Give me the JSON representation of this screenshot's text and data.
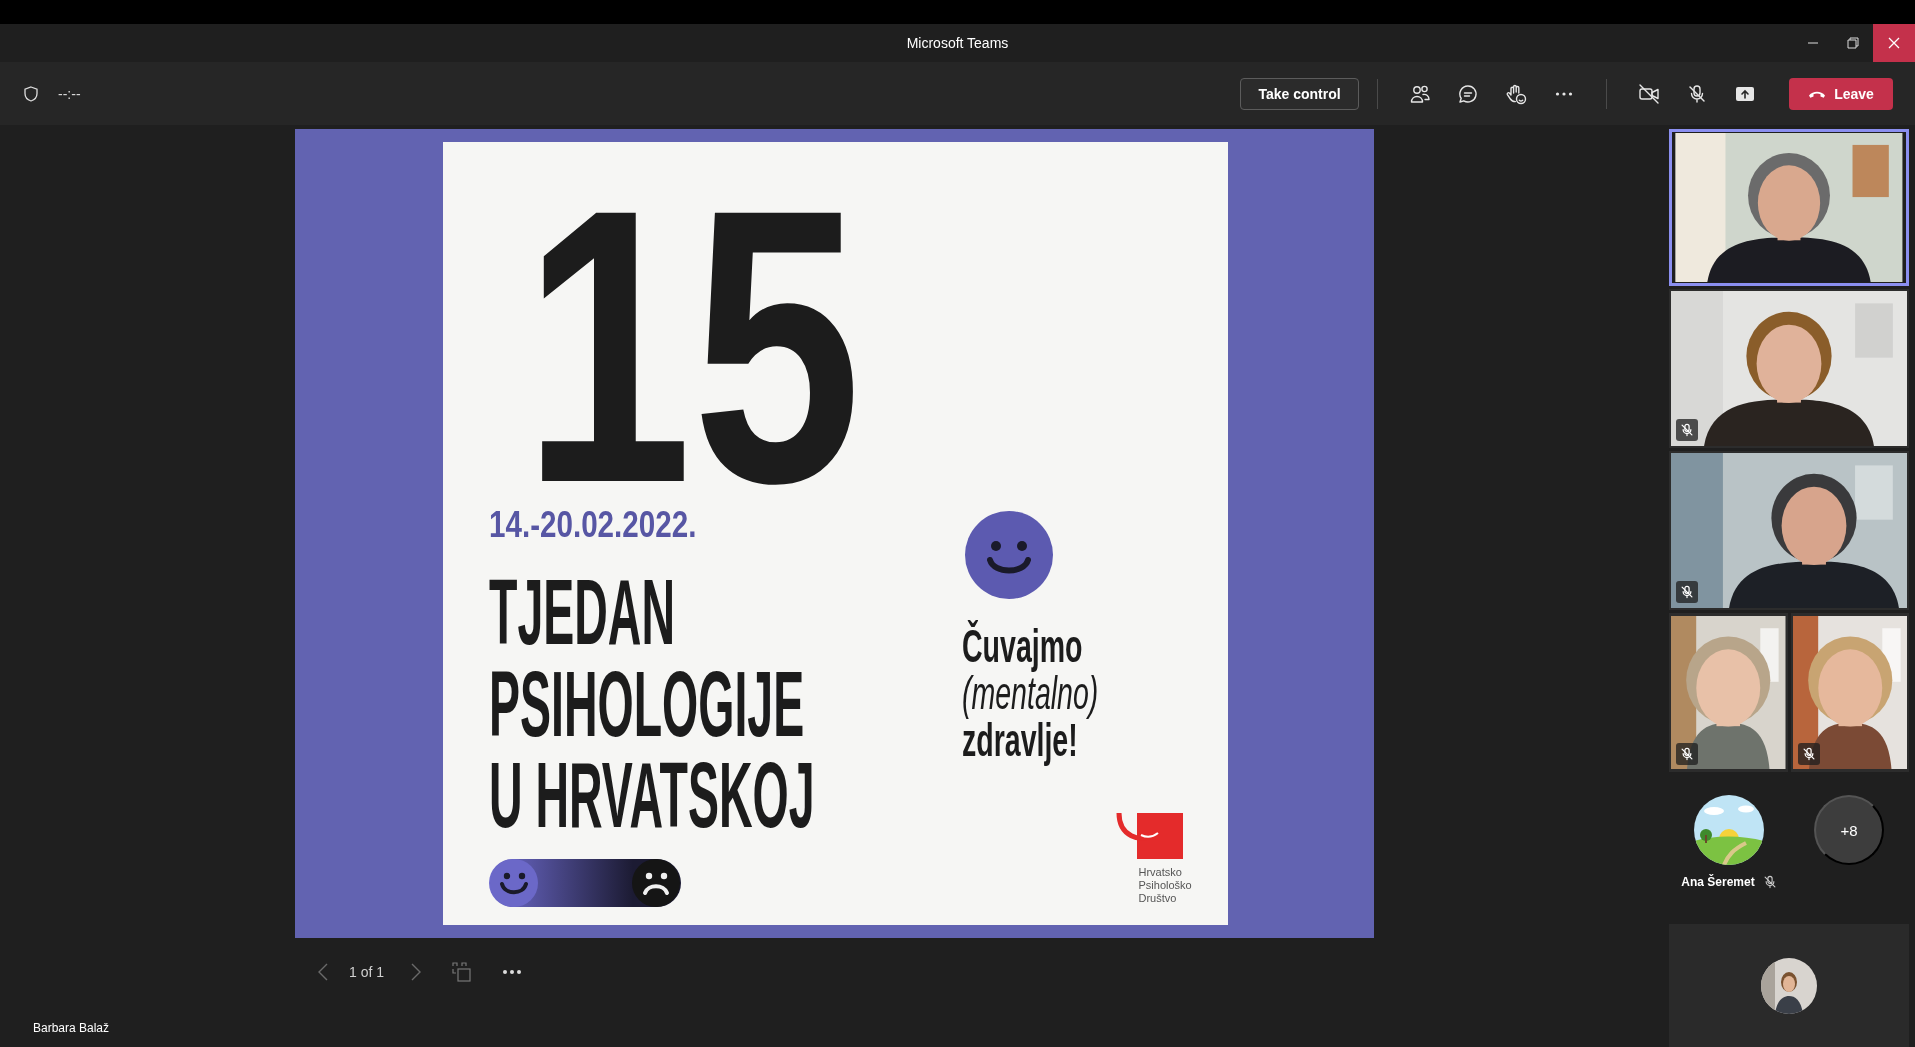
{
  "window": {
    "title": "Microsoft Teams"
  },
  "toolbar": {
    "timer": "--:--",
    "take_control": "Take control",
    "camera_on": false,
    "mic_on": false,
    "leave": "Leave"
  },
  "slide": {
    "number": "15",
    "date": "14.-20.02.2022.",
    "title_lines": [
      "TJEDAN",
      "PSIHOLOGIJE",
      "U HRVATSKOJ"
    ],
    "slogan": [
      {
        "text": "Čuvajmo",
        "italic": false
      },
      {
        "text": "(mentalno)",
        "italic": true
      },
      {
        "text": "zdravlje!",
        "italic": false
      }
    ],
    "logo_lines": [
      "Hrvatsko",
      "Psihološko",
      "Društvo"
    ]
  },
  "pager": {
    "label": "1 of 1"
  },
  "presenter": "Barbara Balaž",
  "participants": [
    {
      "kind": "video",
      "selected": true,
      "muted": false
    },
    {
      "kind": "video",
      "selected": false,
      "muted": true
    },
    {
      "kind": "video",
      "selected": false,
      "muted": true
    },
    {
      "kind": "video",
      "selected": false,
      "muted": true
    },
    {
      "kind": "video",
      "selected": false,
      "muted": true
    }
  ],
  "roster": [
    {
      "kind": "avatar",
      "name": "Ana Šeremet",
      "muted": true
    },
    {
      "kind": "overflow",
      "label": "+8"
    }
  ]
}
